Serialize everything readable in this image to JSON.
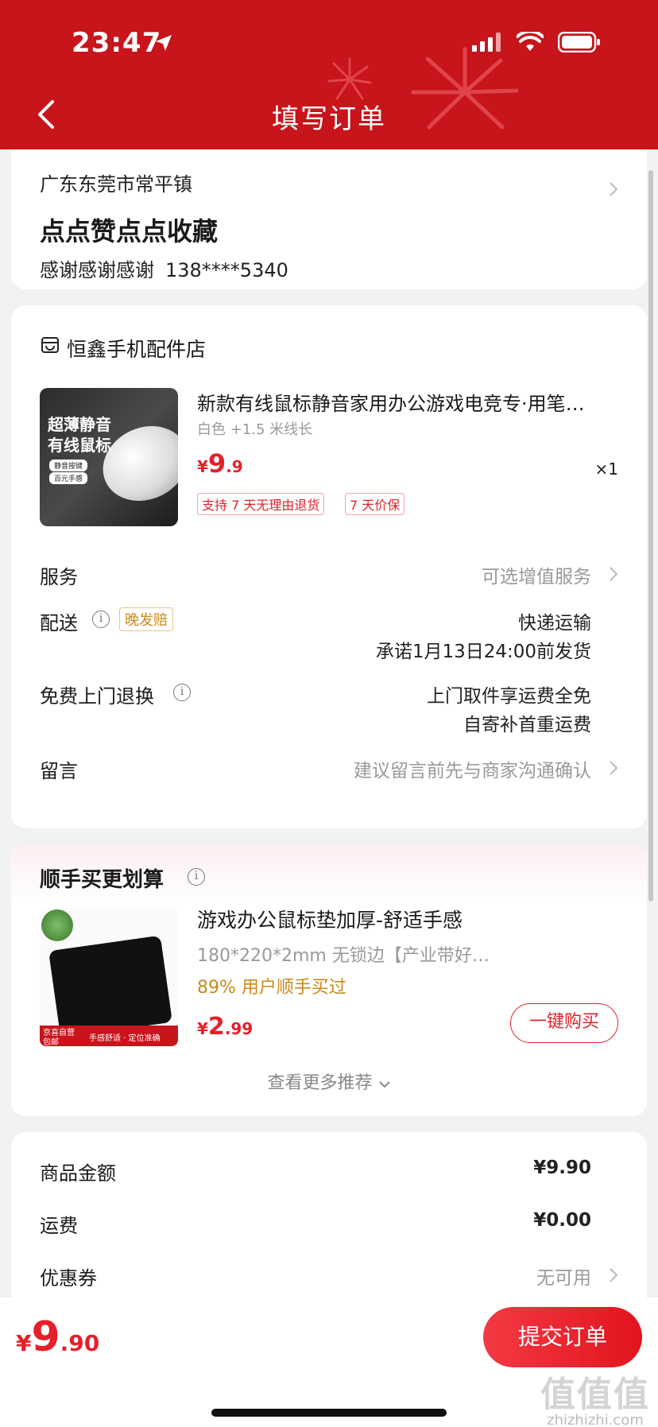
{
  "status_bar": {
    "time": "23:47"
  },
  "header": {
    "title": "填写订单"
  },
  "address": {
    "region": "广东东莞市常平镇",
    "detail": "点点赞点点收藏",
    "name": "感谢感谢感谢",
    "phone": "138****5340"
  },
  "store": {
    "name": "恒鑫手机配件店",
    "product": {
      "image_text_1": "超薄静音",
      "image_text_2": "有线鼠标",
      "image_chip_1": "静音按键",
      "image_chip_2": "百元手感",
      "title": "新款有线鼠标静音家用办公游戏电竞专·用笔…",
      "spec": "白色 +1.5 米线长",
      "price_symbol": "¥",
      "price_int": "9",
      "price_dec": ".9",
      "qty": "×1",
      "tags": [
        "支持 7 天无理由退货",
        "7 天价保"
      ]
    },
    "rows": {
      "service_label": "服务",
      "service_value": "可选增值服务",
      "delivery_label": "配送",
      "delivery_tag": "晚发赔",
      "delivery_value_1": "快递运输",
      "delivery_value_2": "承诺1月13日24:00前发货",
      "return_label": "免费上门退换",
      "return_value_1": "上门取件享运费全免",
      "return_value_2": "自寄补首重运费",
      "message_label": "留言",
      "message_placeholder": "建议留言前先与商家沟通确认"
    }
  },
  "recommend": {
    "title": "顺手买更划算",
    "image_band_1": "京喜自营",
    "image_band_2": "包邮",
    "image_band_3": "手感舒适 · 定位准确",
    "name": "游戏办公鼠标垫加厚-舒适手感",
    "spec": "180*220*2mm 无锁边【产业带好…",
    "rate": "89% 用户顺手买过",
    "price_symbol": "¥",
    "price_int": "2",
    "price_dec": ".99",
    "buy_label": "一键购买",
    "more_label": "查看更多推荐"
  },
  "summary": {
    "goods_label": "商品金额",
    "goods_value": "¥9.90",
    "shipping_label": "运费",
    "shipping_value": "¥0.00",
    "coupon_label": "优惠券",
    "coupon_value": "无可用"
  },
  "footer": {
    "total_symbol": "¥",
    "total_int": "9",
    "total_dec": ".90",
    "submit_label": "提交订单"
  },
  "watermark": {
    "line1": "值值值",
    "line2": "zhizhizhi.com"
  },
  "colors": {
    "brand_red": "#c8141b",
    "price_red": "#e4202a",
    "gold": "#c98a18"
  }
}
